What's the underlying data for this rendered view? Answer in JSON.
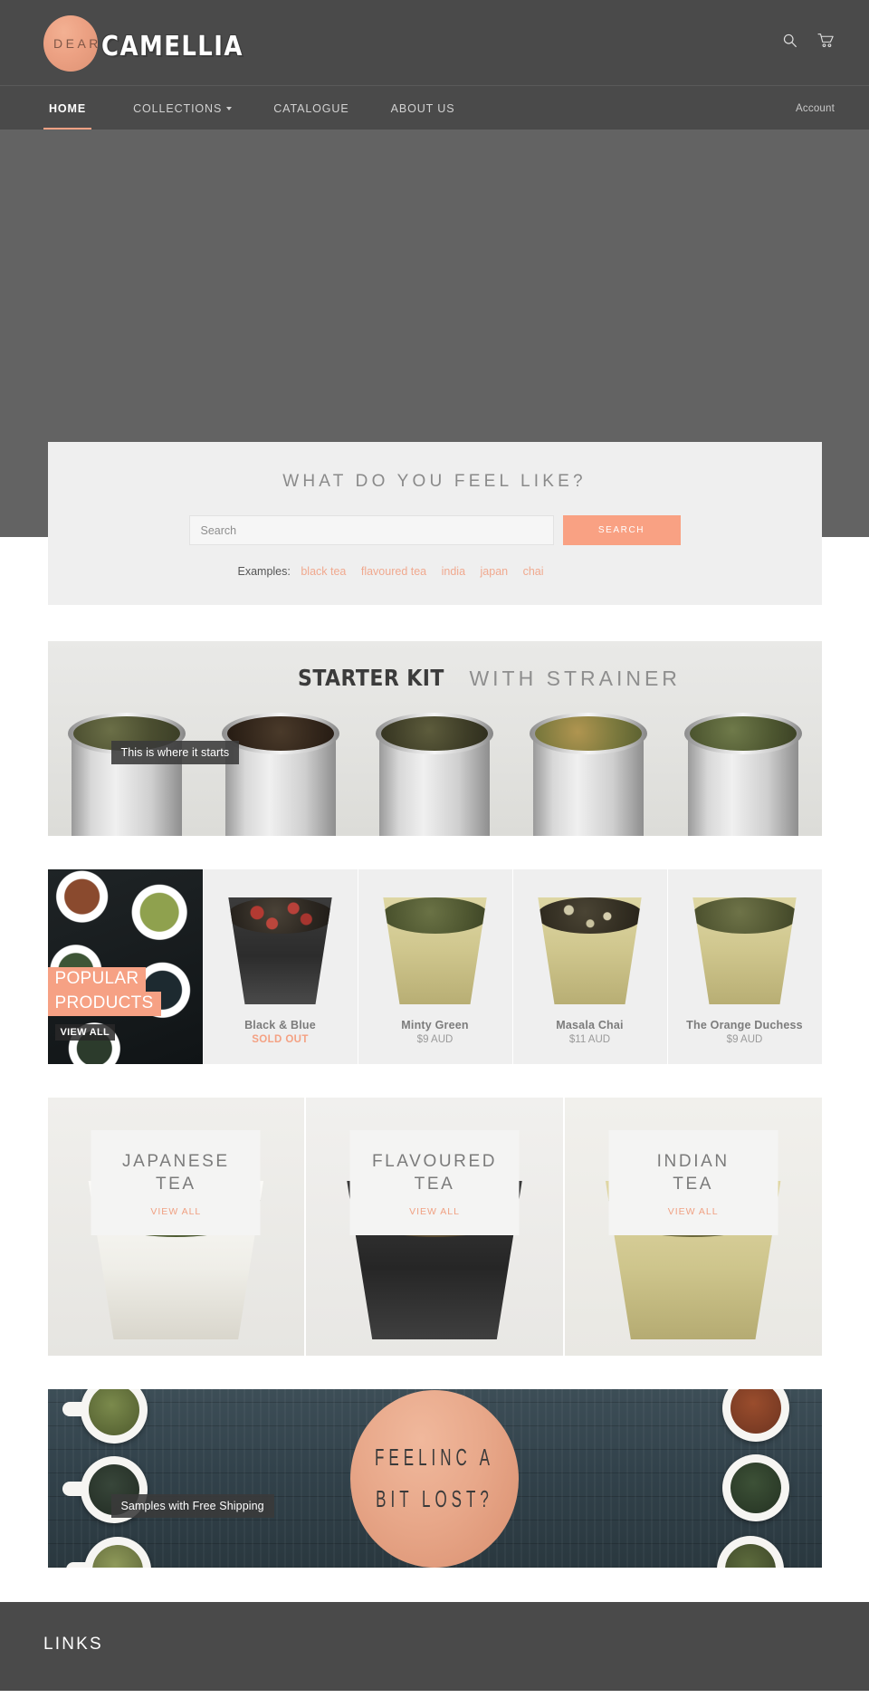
{
  "header": {
    "logo": {
      "word1": "DEAR",
      "word2": "CAMELLIA"
    },
    "icons": {
      "search": "search-icon",
      "cart": "cart-icon"
    }
  },
  "nav": {
    "items": [
      {
        "label": "HOME",
        "active": true,
        "caret": false
      },
      {
        "label": "COLLECTIONS",
        "active": false,
        "caret": true
      },
      {
        "label": "CATALOGUE",
        "active": false,
        "caret": false
      },
      {
        "label": "ABOUT US",
        "active": false,
        "caret": false
      }
    ],
    "account_label": "Account"
  },
  "search_section": {
    "title": "WHAT DO YOU FEEL LIKE?",
    "input_value": "",
    "input_placeholder": "Search",
    "button_label": "SEARCH",
    "examples_label": "Examples:",
    "examples": [
      "black tea",
      "flavoured tea",
      "india",
      "japan",
      "chai"
    ]
  },
  "starter_banner": {
    "title_bold": "STARTER KIT",
    "title_light": "WITH STRAINER",
    "caption": "This is where it starts"
  },
  "popular": {
    "promo": {
      "line1": "POPULAR",
      "line2": "PRODUCTS",
      "view_all": "VIEW ALL"
    },
    "products": [
      {
        "title": "Black & Blue",
        "price": "SOLD OUT",
        "sold_out": true
      },
      {
        "title": "Minty Green",
        "price": "$9 AUD",
        "sold_out": false
      },
      {
        "title": "Masala Chai",
        "price": "$11 AUD",
        "sold_out": false
      },
      {
        "title": "The Orange Duchess",
        "price": "$9 AUD",
        "sold_out": false
      }
    ]
  },
  "categories": [
    {
      "title": "JAPANESE\nTEA",
      "view_all": "VIEW ALL"
    },
    {
      "title": "FLAVOURED\nTEA",
      "view_all": "VIEW ALL"
    },
    {
      "title": "INDIAN\nTEA",
      "view_all": "VIEW ALL"
    }
  ],
  "lost_banner": {
    "line1": "FEELINC A",
    "line2": "BIT LOST?",
    "caption": "Samples with Free Shipping"
  },
  "footer": {
    "title": "LINKS"
  },
  "colors": {
    "accent": "#f4a183",
    "header_bg": "#4a4a4a",
    "hero_bg": "#636363",
    "panel_bg": "#efefef"
  }
}
